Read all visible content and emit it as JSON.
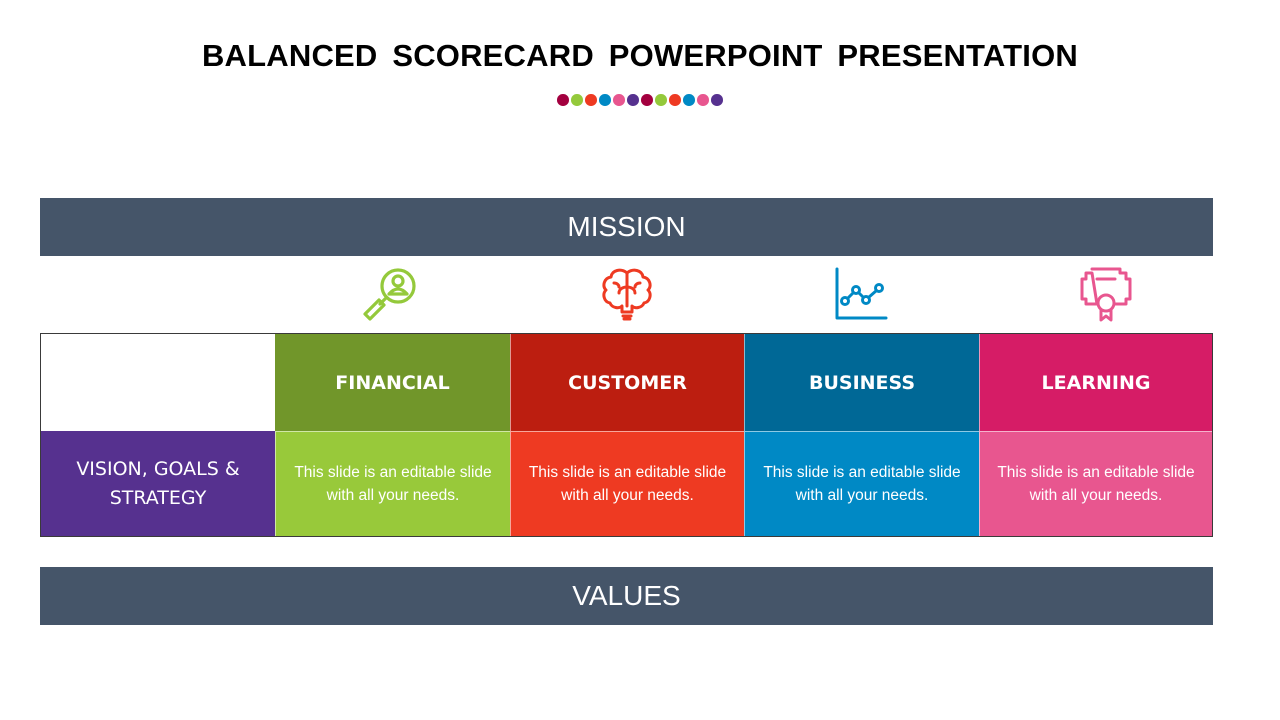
{
  "title": "BALANCED SCORECARD POWERPOINT PRESENTATION",
  "decor_dots": [
    "#a3003f",
    "#94c93b",
    "#ee3a22",
    "#0089c5",
    "#e8568f",
    "#56318f",
    "#a3003f",
    "#94c93b",
    "#ee3a22",
    "#0089c5",
    "#e8568f",
    "#56318f"
  ],
  "mission_label": "MISSION",
  "values_label": "VALUES",
  "row_label": "VISION, GOALS & STRATEGY",
  "perspectives": [
    {
      "name": "FINANCIAL",
      "icon": "magnifier-user-icon",
      "header_color": "#71962a",
      "body_color": "#98c93a",
      "icon_color": "#94c93b",
      "text": "This slide is an editable slide with all your needs."
    },
    {
      "name": "CUSTOMER",
      "icon": "brain-bulb-icon",
      "header_color": "#bc1e10",
      "body_color": "#ee3a22",
      "icon_color": "#ee3a22",
      "text": "This slide is an editable slide with all your needs."
    },
    {
      "name": "BUSINESS",
      "icon": "line-chart-icon",
      "header_color": "#006896",
      "body_color": "#0089c5",
      "icon_color": "#0089c5",
      "text": "This slide is an editable slide with all your needs."
    },
    {
      "name": "LEARNING",
      "icon": "certificate-icon",
      "header_color": "#d61c66",
      "body_color": "#e8568f",
      "icon_color": "#e8568f",
      "text": "This slide is an editable slide with all your needs."
    }
  ],
  "colors": {
    "banner": "#455569",
    "vision": "#56318f"
  }
}
